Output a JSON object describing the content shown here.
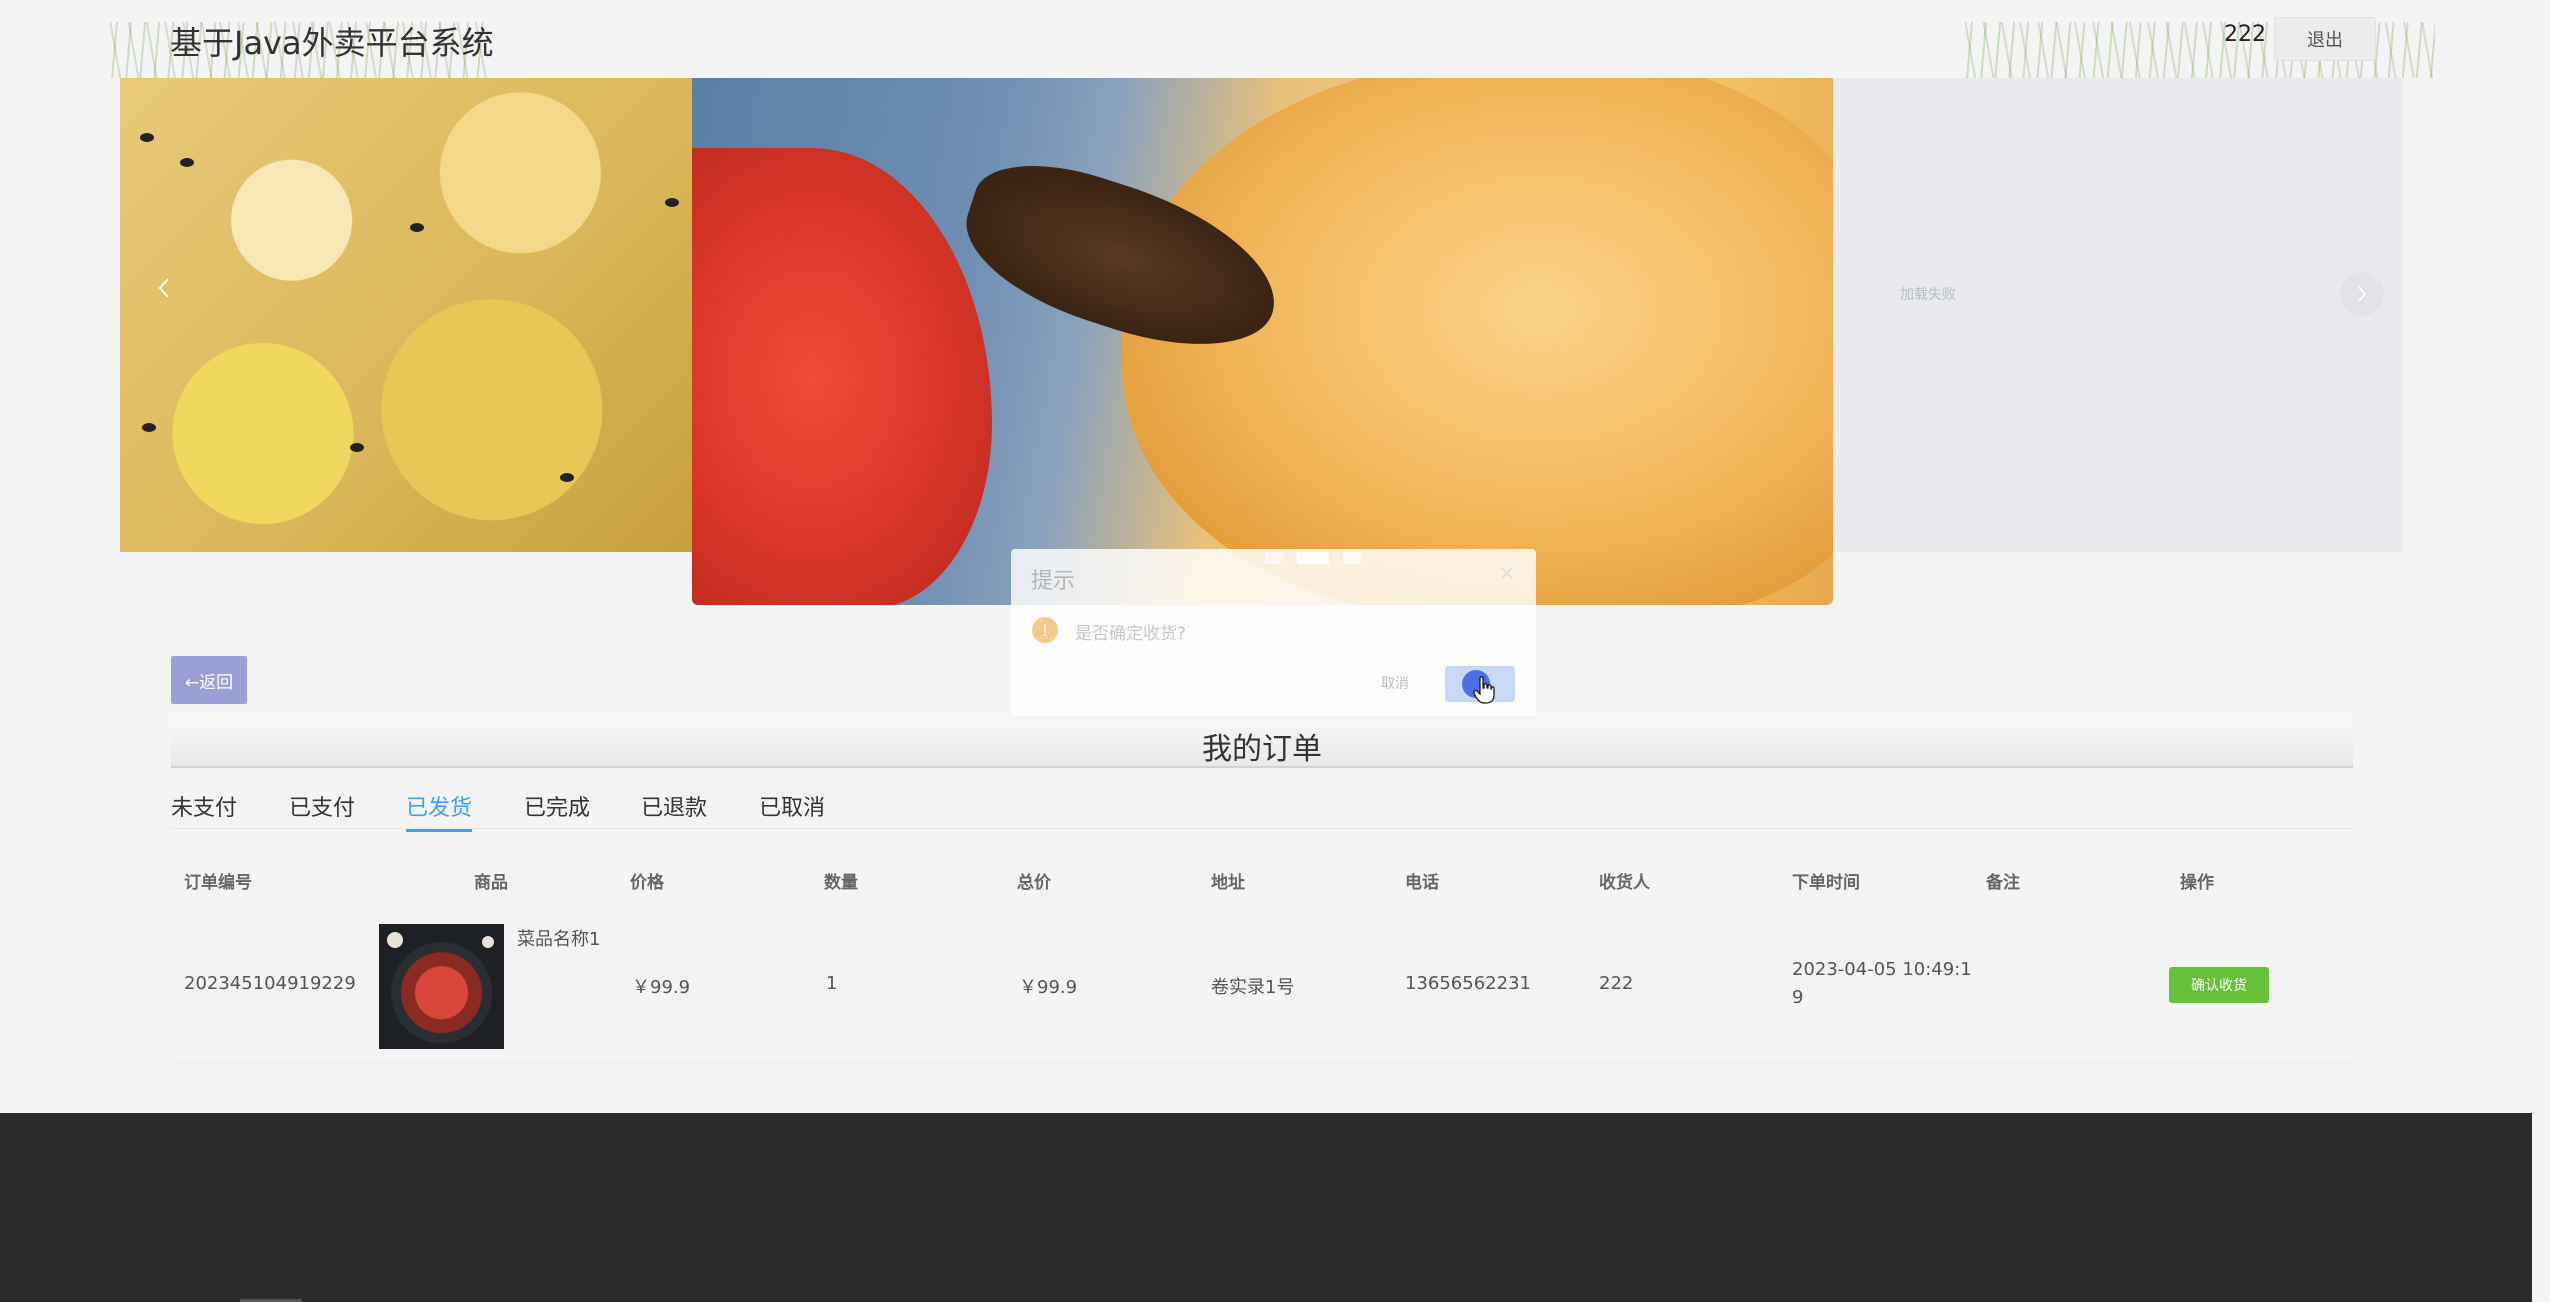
{
  "header": {
    "title": "基于Java外卖平台系统",
    "user_name": "222",
    "logout_label": "退出"
  },
  "carousel": {
    "load_failed_text": "加载失败",
    "prev_icon": "chevron-left-icon",
    "next_icon": "chevron-right-icon",
    "indicator_count": 3,
    "active_index": 1
  },
  "dialog": {
    "title": "提示",
    "message": "是否确定收货?",
    "cancel_label": "取消",
    "ok_label": "确定",
    "warning_icon": "warning-icon"
  },
  "back_label": "←返回",
  "orders": {
    "title": "我的订单",
    "tabs": [
      {
        "label": "未支付"
      },
      {
        "label": "已支付"
      },
      {
        "label": "已发货",
        "active": true
      },
      {
        "label": "已完成"
      },
      {
        "label": "已退款"
      },
      {
        "label": "已取消"
      }
    ],
    "columns": [
      "订单编号",
      "商品",
      "价格",
      "数量",
      "总价",
      "地址",
      "电话",
      "收货人",
      "下单时间",
      "备注",
      "操作"
    ],
    "rows": [
      {
        "order_no": "202345104919229",
        "product_name": "菜品名称1",
        "price": "￥99.9",
        "quantity": "1",
        "total": "￥99.9",
        "address": "卷实录1号",
        "phone": "13656562231",
        "receiver": "222",
        "order_time_line1": "2023-04-05 10:49:1",
        "order_time_line2": "9",
        "remark": "",
        "action_label": "确认收货"
      }
    ]
  },
  "colors": {
    "accent": "#409eff",
    "success": "#67c23a",
    "back_button": "#9aa0d5",
    "footer": "#2b2b2b"
  }
}
